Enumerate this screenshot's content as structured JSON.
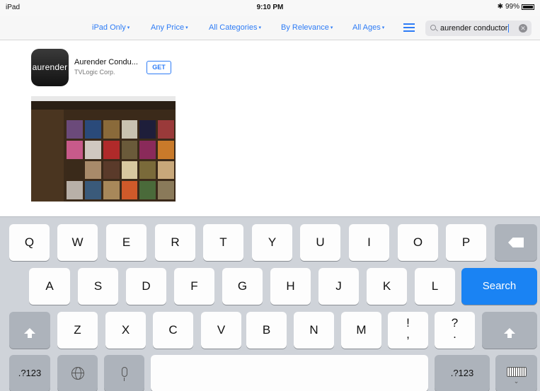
{
  "status_bar": {
    "device": "iPad",
    "time": "9:10 PM",
    "battery": "99%"
  },
  "filters": {
    "device": "iPad Only",
    "price": "Any Price",
    "categories": "All Categories",
    "sort": "By Relevance",
    "ages": "All Ages",
    "caret": "▾"
  },
  "search": {
    "value": "aurender conductor",
    "clear_glyph": "✕"
  },
  "result": {
    "icon_text": "aurender",
    "app_name": "Aurender Condu...",
    "developer": "TVLogic Corp.",
    "get_label": "GET"
  },
  "keyboard": {
    "row1": [
      "Q",
      "W",
      "E",
      "R",
      "T",
      "Y",
      "U",
      "I",
      "O",
      "P"
    ],
    "row2": [
      "A",
      "S",
      "D",
      "F",
      "G",
      "H",
      "J",
      "K",
      "L"
    ],
    "row3": [
      "Z",
      "X",
      "C",
      "V",
      "B",
      "N",
      "M"
    ],
    "exclam_top": "!",
    "exclam_bottom": ",",
    "question_top": "?",
    "question_bottom": ".",
    "search_label": "Search",
    "numbers_label": ".?123",
    "keyboard_caret": "⌄"
  },
  "colors": {
    "accent": "#2e7cf6",
    "search_key": "#1a83f3",
    "keyboard_bg": "#cfd3d9"
  }
}
